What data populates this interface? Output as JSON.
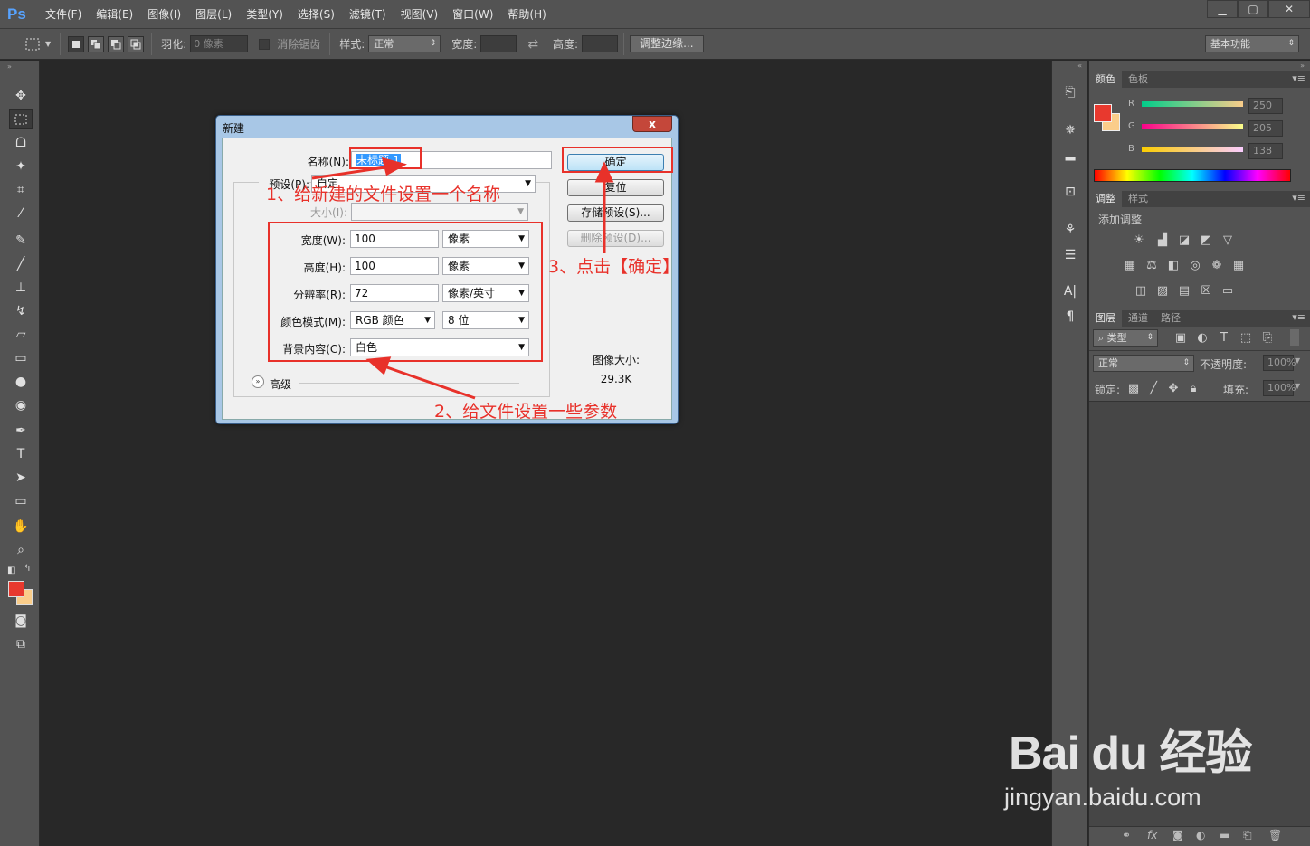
{
  "app": {
    "logo": "Ps"
  },
  "menu": [
    "文件(F)",
    "编辑(E)",
    "图像(I)",
    "图层(L)",
    "类型(Y)",
    "选择(S)",
    "滤镜(T)",
    "视图(V)",
    "窗口(W)",
    "帮助(H)"
  ],
  "window_controls": {
    "minimize": "▁",
    "restore": "▢",
    "close": "✕"
  },
  "options": {
    "feather_label": "羽化:",
    "feather_value": "0 像素",
    "antialias_label": "消除锯齿",
    "style_label": "样式:",
    "style_value": "正常",
    "width_label": "宽度:",
    "height_label": "高度:",
    "refine_edge": "调整边缘...",
    "workspace": "基本功能"
  },
  "color_panel": {
    "tabs": [
      "颜色",
      "色板"
    ],
    "r_label": "R",
    "g_label": "G",
    "b_label": "B",
    "r_value": "250",
    "g_value": "205",
    "b_value": "138",
    "foreground": "#e8392e",
    "background": "#facd8a"
  },
  "adjust_panel": {
    "tabs": [
      "调整",
      "样式"
    ],
    "add_label": "添加调整"
  },
  "layers_panel": {
    "tabs": [
      "图层",
      "通道",
      "路径"
    ],
    "kind_filter": "类型",
    "blend_mode": "正常",
    "opacity_label": "不透明度:",
    "opacity_value": "100%",
    "lock_label": "锁定:",
    "fill_label": "填充:",
    "fill_value": "100%"
  },
  "dialog": {
    "title": "新建",
    "close": "x",
    "name_label": "名称(N):",
    "name_value": "未标题-1",
    "preset_label": "预设(P):",
    "preset_value": "自定",
    "size_label": "大小(I):",
    "width_label": "宽度(W):",
    "width_value": "100",
    "width_unit": "像素",
    "height_label": "高度(H):",
    "height_value": "100",
    "height_unit": "像素",
    "resolution_label": "分辨率(R):",
    "resolution_value": "72",
    "resolution_unit": "像素/英寸",
    "color_mode_label": "颜色模式(M):",
    "color_mode_value": "RGB 颜色",
    "bit_depth_value": "8 位",
    "background_label": "背景内容(C):",
    "background_value": "白色",
    "advanced_label": "高级",
    "ok": "确定",
    "reset": "复位",
    "save_preset": "存储预设(S)...",
    "delete_preset": "删除预设(D)...",
    "image_size_label": "图像大小:",
    "image_size_value": "29.3K"
  },
  "annotations": {
    "step1": "1、给新建的文件设置一个名称",
    "step2": "2、给文件设置一些参数",
    "step3": "3、点击【确定】"
  },
  "watermark": {
    "logo": "Bai du 经验",
    "url": "jingyan.baidu.com"
  },
  "colors": {
    "accent_red": "#e8312a",
    "panel_bg": "#535353",
    "canvas_bg": "#282828"
  }
}
